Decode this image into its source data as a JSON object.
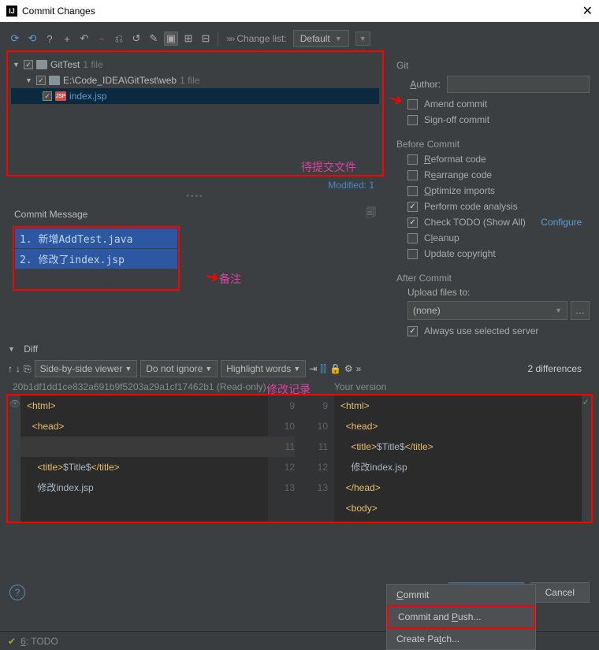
{
  "window": {
    "title": "Commit Changes"
  },
  "toolbar": {
    "changelist_label": "Change list:",
    "changelist_value": "Default"
  },
  "tree": {
    "root": {
      "name": "GitTest",
      "suffix": "1 file"
    },
    "path": {
      "name": "E:\\Code_IDEA\\GitTest\\web",
      "suffix": "1 file"
    },
    "file": {
      "name": "index.jsp"
    },
    "modified": "Modified: 1"
  },
  "commit_message": {
    "heading": "Commit Message",
    "line1": "1. 新增AddTest.java",
    "line2": "2. 修改了index.jsp"
  },
  "annotations": {
    "pending_files": "待提交文件",
    "remark": "备注",
    "change_log": "修改记录"
  },
  "git_panel": {
    "heading": "Git",
    "author_label": "Author:",
    "amend": "Amend commit",
    "signoff": "Sign-off commit",
    "before_heading": "Before Commit",
    "reformat": "Reformat code",
    "rearrange": "Rearrange code",
    "optimize": "Optimize imports",
    "analysis": "Perform code analysis",
    "todo": "Check TODO (Show All)",
    "configure": "Configure",
    "cleanup": "Cleanup",
    "copyright": "Update copyright",
    "after_heading": "After Commit",
    "upload_label": "Upload files to:",
    "upload_value": "(none)",
    "always_server": "Always use selected server"
  },
  "diff": {
    "heading": "Diff",
    "viewer": "Side-by-side viewer",
    "ignore": "Do not ignore",
    "highlight": "Highlight words",
    "count": "2 differences",
    "left_label": "20b1df1dd1ce832a691b9f5203a29a1cf17462b1 (Read-only)",
    "right_label": "Your version",
    "lines_left": [
      "<html>",
      "  <head>",
      "",
      "    <title>$Title$</title>",
      "    修改index.jsp"
    ],
    "lines_right": [
      "<html>",
      "  <head>",
      "    <title>$Title$</title>",
      "    修改index.jsp",
      "  </head>",
      "  <body>"
    ],
    "gutter_left": [
      "9",
      "10",
      "11",
      "12",
      "13"
    ],
    "gutter_right": [
      "9",
      "10",
      "11",
      "12",
      "13",
      ""
    ]
  },
  "buttons": {
    "commit": "Commit",
    "cancel": "Cancel",
    "menu_commit": "Commit",
    "menu_commit_push": "Commit and Push...",
    "menu_patch": "Create Patch..."
  },
  "status": {
    "todo": "6: TODO"
  }
}
